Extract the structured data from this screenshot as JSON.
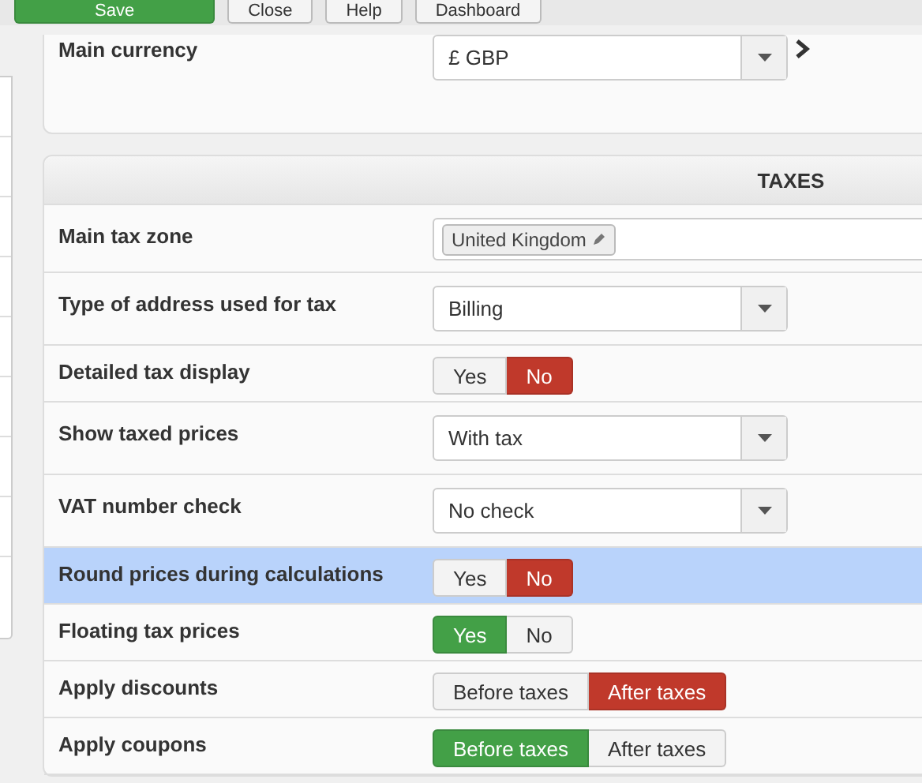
{
  "toolbar": [
    {
      "label": "Save",
      "kind": "primary"
    },
    {
      "label": "Close",
      "kind": "default"
    },
    {
      "label": "Help",
      "kind": "default"
    },
    {
      "label": "Dashboard",
      "kind": "default"
    }
  ],
  "currency": {
    "label": "Main currency",
    "value": "£ GBP"
  },
  "taxes": {
    "title": "TAXES",
    "rows": [
      {
        "label": "Main tax zone",
        "kind": "tags",
        "highlighted": false,
        "tags": [
          "United Kingdom"
        ]
      },
      {
        "label": "Type of address used for tax",
        "kind": "select",
        "highlighted": false,
        "value": "Billing"
      },
      {
        "label": "Detailed tax display",
        "kind": "toggle",
        "highlighted": false,
        "options": [
          {
            "label": "Yes",
            "selected": false
          },
          {
            "label": "No",
            "selected": true
          }
        ]
      },
      {
        "label": "Show taxed prices",
        "kind": "select",
        "highlighted": false,
        "value": "With tax"
      },
      {
        "label": "VAT number check",
        "kind": "select",
        "highlighted": false,
        "value": "No check"
      },
      {
        "label": "Round prices during calculations",
        "kind": "toggle",
        "highlighted": true,
        "options": [
          {
            "label": "Yes",
            "selected": false
          },
          {
            "label": "No",
            "selected": true
          }
        ]
      },
      {
        "label": "Floating tax prices",
        "kind": "toggle",
        "highlighted": false,
        "options": [
          {
            "label": "Yes",
            "selected": true
          },
          {
            "label": "No",
            "selected": false
          }
        ]
      },
      {
        "label": "Apply discounts",
        "kind": "toggle",
        "highlighted": false,
        "options": [
          {
            "label": "Before taxes",
            "selected": false
          },
          {
            "label": "After taxes",
            "selected": true
          }
        ]
      },
      {
        "label": "Apply coupons",
        "kind": "toggle",
        "highlighted": false,
        "options": [
          {
            "label": "Before taxes",
            "selected": true
          },
          {
            "label": "After taxes",
            "selected": false
          }
        ]
      }
    ]
  }
}
